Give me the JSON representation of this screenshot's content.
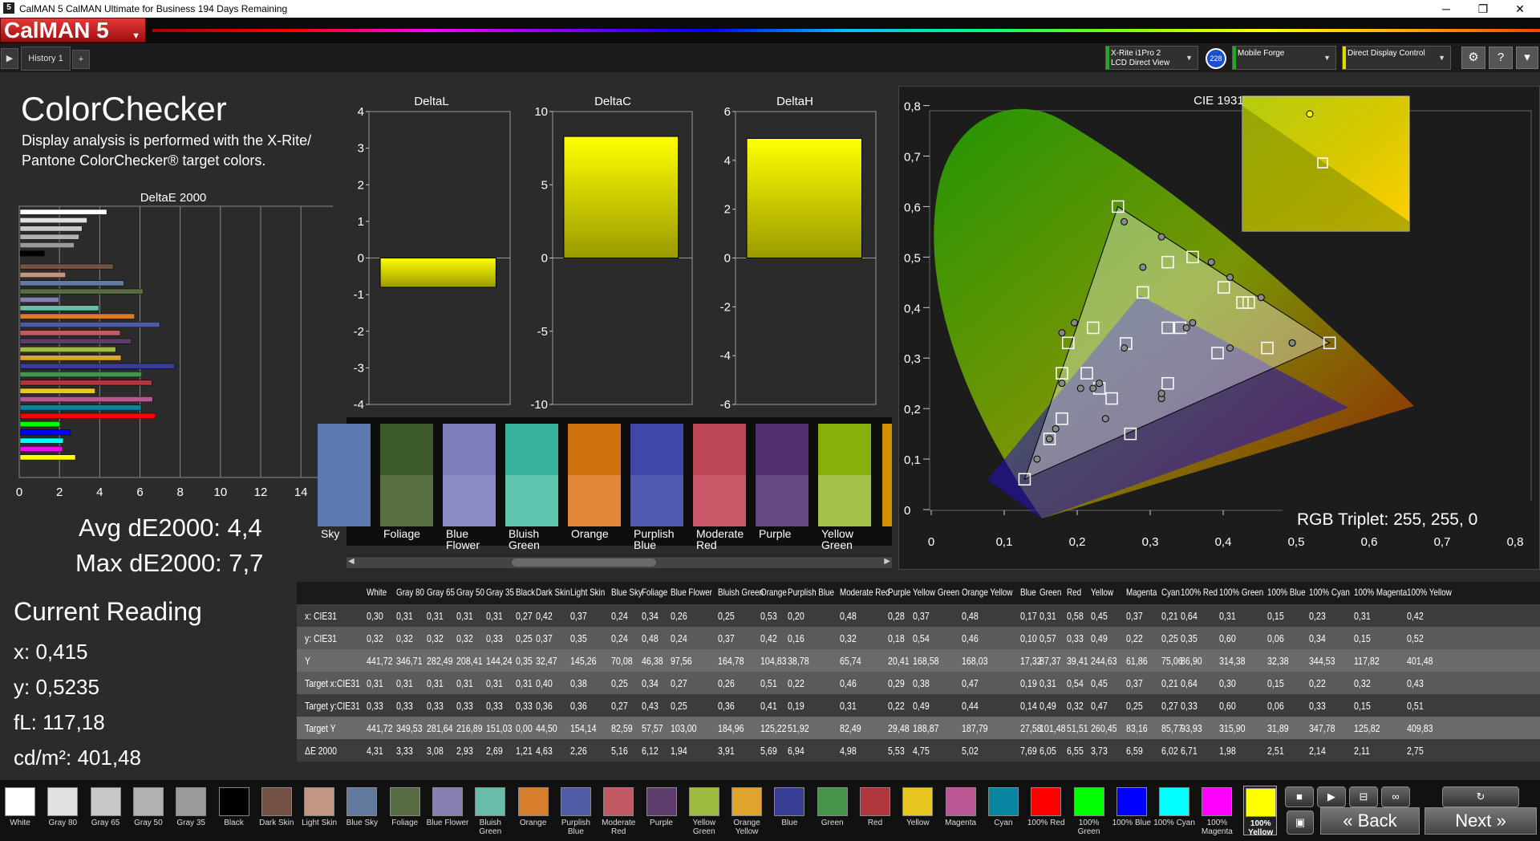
{
  "window": {
    "title": "CalMAN 5 CalMAN Ultimate for Business 194 Days Remaining",
    "app_icon": "5",
    "minimize": "─",
    "restore": "❐",
    "close": "✕"
  },
  "logo": "CalMAN 5",
  "tabs": {
    "history": "History 1",
    "add": "+"
  },
  "devices": {
    "meter_line1": "X-Rite i1Pro 2",
    "meter_line2": "LCD Direct View",
    "meter_badge": "228",
    "source": "Mobile Forge",
    "display": "Direct Display Control"
  },
  "colors": {
    "meter_bar": "#22aa22",
    "source_bar": "#22aa22",
    "display_bar": "#dddd00",
    "yellow": "#ffff00"
  },
  "left": {
    "title": "ColorChecker",
    "desc1": "Display analysis is performed with the X-Rite/",
    "desc2": "Pantone ColorChecker® target colors.",
    "de_title": "DeltaE 2000",
    "avg": "Avg dE2000: 4,4",
    "max": "Max dE2000: 7,7"
  },
  "current": {
    "title": "Current Reading",
    "x": "x: 0,415",
    "y": "y: 0,5235",
    "fl": "fL: 117,18",
    "cdm": "cd/m²: 401,48"
  },
  "delta_titles": {
    "l": "DeltaL",
    "c": "DeltaC",
    "h": "DeltaH"
  },
  "cie": {
    "title": "CIE 1931 xy",
    "triplet": "RGB Triplet: 255, 255, 0"
  },
  "swatches": [
    {
      "label": "Sky",
      "color": "#5b7bb0",
      "meas": "#5b7bb0"
    },
    {
      "label": "Foliage",
      "color": "#3d5a2c",
      "meas": "#5a6e44"
    },
    {
      "label": "Blue Flower",
      "color": "#7e7dbb",
      "meas": "#8b8bc5"
    },
    {
      "label": "Bluish Green",
      "color": "#38b49e",
      "meas": "#5ec4ae"
    },
    {
      "label": "Orange",
      "color": "#d0720c",
      "meas": "#e38637"
    },
    {
      "label": "Purplish Blue",
      "color": "#3e48a8",
      "meas": "#4f5aae"
    },
    {
      "label": "Moderate Red",
      "color": "#bc4556",
      "meas": "#c95968"
    },
    {
      "label": "Purple",
      "color": "#503070",
      "meas": "#644880"
    },
    {
      "label": "Yellow Green",
      "color": "#86b00c",
      "meas": "#a4c24a"
    }
  ],
  "chart_data": [
    {
      "type": "bar",
      "title": "DeltaE 2000",
      "orientation": "horizontal",
      "xlim": [
        0,
        15
      ],
      "xticks": [
        "0",
        "2",
        "4",
        "6",
        "8",
        "10",
        "12",
        "14"
      ],
      "categories": [
        "White",
        "Gray 80",
        "Gray 65",
        "Gray 50",
        "Gray 35",
        "Black",
        "Dark Skin",
        "Light Skin",
        "Blue Sky",
        "Foliage",
        "Blue Flower",
        "Bluish Green",
        "Orange",
        "Purplish Blue",
        "Moderate Red",
        "Purple",
        "Yellow Green",
        "Orange Yellow",
        "Blue",
        "Green",
        "Red",
        "Yellow",
        "Magenta",
        "Cyan",
        "100% Red",
        "100% Green",
        "100% Blue",
        "100% Cyan",
        "100% Magenta",
        "100% Yellow"
      ],
      "values": [
        4.31,
        3.33,
        3.08,
        2.93,
        2.69,
        1.21,
        4.63,
        2.26,
        5.16,
        6.12,
        1.94,
        3.91,
        5.69,
        6.94,
        4.98,
        5.53,
        4.75,
        5.02,
        7.69,
        6.05,
        6.55,
        3.73,
        6.59,
        6.02,
        6.71,
        1.98,
        2.51,
        2.14,
        2.11,
        2.75
      ]
    },
    {
      "type": "bar",
      "title": "DeltaL",
      "ylim": [
        -4,
        4
      ],
      "yticks": [
        "4",
        "3",
        "2",
        "1",
        "0",
        "-1",
        "-2",
        "-3",
        "-4"
      ],
      "values": [
        -0.8
      ]
    },
    {
      "type": "bar",
      "title": "DeltaC",
      "ylim": [
        -10,
        10
      ],
      "yticks": [
        "10",
        "5",
        "0",
        "-5",
        "-10"
      ],
      "values": [
        8.3
      ]
    },
    {
      "type": "bar",
      "title": "DeltaH",
      "ylim": [
        -6,
        6
      ],
      "yticks": [
        "6",
        "4",
        "2",
        "0",
        "-2",
        "-4",
        "-6"
      ],
      "values": [
        4.9
      ]
    },
    {
      "type": "scatter",
      "title": "CIE 1931 xy",
      "xlim": [
        0,
        0.8
      ],
      "ylim": [
        0,
        0.8
      ],
      "xticks": [
        "0",
        "0,1",
        "0,2",
        "0,3",
        "0,4",
        "0,5",
        "0,6",
        "0,7",
        "0,8"
      ],
      "yticks": [
        "0",
        "0,1",
        "0,2",
        "0,3",
        "0,4",
        "0,5",
        "0,6",
        "0,7",
        "0,8"
      ],
      "gamut_measured": [
        [
          0.64,
          0.33
        ],
        [
          0.3,
          0.6
        ],
        [
          0.15,
          0.06
        ]
      ],
      "targets": [
        [
          0.313,
          0.329
        ],
        [
          0.4,
          0.36
        ],
        [
          0.38,
          0.36
        ],
        [
          0.25,
          0.27
        ],
        [
          0.34,
          0.43
        ],
        [
          0.27,
          0.24
        ],
        [
          0.5,
          0.41
        ],
        [
          0.21,
          0.18
        ],
        [
          0.46,
          0.31
        ],
        [
          0.29,
          0.22
        ],
        [
          0.38,
          0.49
        ],
        [
          0.47,
          0.44
        ],
        [
          0.15,
          0.06
        ],
        [
          0.3,
          0.6
        ],
        [
          0.64,
          0.33
        ],
        [
          0.42,
          0.5
        ],
        [
          0.32,
          0.15
        ],
        [
          0.22,
          0.33
        ],
        [
          0.19,
          0.14
        ],
        [
          0.26,
          0.36
        ],
        [
          0.38,
          0.25
        ],
        [
          0.54,
          0.32
        ],
        [
          0.21,
          0.27
        ],
        [
          0.51,
          0.41
        ]
      ],
      "measured": [
        [
          0.31,
          0.32
        ],
        [
          0.41,
          0.36
        ],
        [
          0.42,
          0.37
        ],
        [
          0.24,
          0.24
        ],
        [
          0.34,
          0.48
        ],
        [
          0.26,
          0.24
        ],
        [
          0.53,
          0.42
        ],
        [
          0.2,
          0.16
        ],
        [
          0.48,
          0.32
        ],
        [
          0.28,
          0.18
        ],
        [
          0.37,
          0.54
        ],
        [
          0.45,
          0.49
        ],
        [
          0.17,
          0.1
        ],
        [
          0.31,
          0.57
        ],
        [
          0.58,
          0.33
        ],
        [
          0.45,
          0.49
        ],
        [
          0.37,
          0.22
        ],
        [
          0.21,
          0.25
        ],
        [
          0.19,
          0.14
        ],
        [
          0.23,
          0.37
        ],
        [
          0.37,
          0.23
        ],
        [
          0.58,
          0.33
        ],
        [
          0.21,
          0.35
        ],
        [
          0.48,
          0.46
        ],
        [
          0.27,
          0.25
        ]
      ]
    }
  ],
  "table": {
    "columns": [
      "White",
      "Gray 80",
      "Gray 65",
      "Gray 50",
      "Gray 35",
      "Black",
      "Dark Skin",
      "Light Skin",
      "Blue Sky",
      "Foliage",
      "Blue Flower",
      "Bluish Green",
      "Orange",
      "Purplish Blue",
      "Moderate Red",
      "Purple",
      "Yellow Green",
      "Orange Yellow",
      "Blue",
      "Green",
      "Red",
      "Yellow",
      "Magenta",
      "Cyan",
      "100% Red",
      "100% Green",
      "100% Blue",
      "100% Cyan",
      "100% Magenta",
      "100% Yellow"
    ],
    "rows": [
      {
        "label": "x: CIE31",
        "values": [
          "0,30",
          "0,31",
          "0,31",
          "0,31",
          "0,31",
          "0,27",
          "0,42",
          "0,37",
          "0,24",
          "0,34",
          "0,26",
          "0,25",
          "0,53",
          "0,20",
          "0,48",
          "0,28",
          "0,37",
          "0,48",
          "0,17",
          "0,31",
          "0,58",
          "0,45",
          "0,37",
          "0,21",
          "0,64",
          "0,31",
          "0,15",
          "0,23",
          "0,31",
          "0,42"
        ]
      },
      {
        "label": "y: CIE31",
        "values": [
          "0,32",
          "0,32",
          "0,32",
          "0,32",
          "0,33",
          "0,25",
          "0,37",
          "0,35",
          "0,24",
          "0,48",
          "0,24",
          "0,37",
          "0,42",
          "0,16",
          "0,32",
          "0,18",
          "0,54",
          "0,46",
          "0,10",
          "0,57",
          "0,33",
          "0,49",
          "0,22",
          "0,25",
          "0,35",
          "0,60",
          "0,06",
          "0,34",
          "0,15",
          "0,52"
        ]
      },
      {
        "label": "Y",
        "values": [
          "441,72",
          "346,71",
          "282,49",
          "208,41",
          "144,24",
          "0,35",
          "32,47",
          "145,26",
          "70,08",
          "46,38",
          "97,56",
          "164,78",
          "104,83",
          "38,78",
          "65,74",
          "20,41",
          "168,58",
          "168,03",
          "17,32",
          "87,37",
          "39,41",
          "244,63",
          "61,86",
          "75,06",
          "86,90",
          "314,38",
          "32,38",
          "344,53",
          "117,82",
          "401,48"
        ]
      },
      {
        "label": "Target x:CIE31",
        "values": [
          "0,31",
          "0,31",
          "0,31",
          "0,31",
          "0,31",
          "0,31",
          "0,40",
          "0,38",
          "0,25",
          "0,34",
          "0,27",
          "0,26",
          "0,51",
          "0,22",
          "0,46",
          "0,29",
          "0,38",
          "0,47",
          "0,19",
          "0,31",
          "0,54",
          "0,45",
          "0,37",
          "0,21",
          "0,64",
          "0,30",
          "0,15",
          "0,22",
          "0,32",
          "0,43"
        ]
      },
      {
        "label": "Target y:CIE31",
        "values": [
          "0,33",
          "0,33",
          "0,33",
          "0,33",
          "0,33",
          "0,33",
          "0,36",
          "0,36",
          "0,27",
          "0,43",
          "0,25",
          "0,36",
          "0,41",
          "0,19",
          "0,31",
          "0,22",
          "0,49",
          "0,44",
          "0,14",
          "0,49",
          "0,32",
          "0,47",
          "0,25",
          "0,27",
          "0,33",
          "0,60",
          "0,06",
          "0,33",
          "0,15",
          "0,51"
        ]
      },
      {
        "label": "Target Y",
        "values": [
          "441,72",
          "349,53",
          "281,64",
          "216,89",
          "151,03",
          "0,00",
          "44,50",
          "154,14",
          "82,59",
          "57,57",
          "103,00",
          "184,96",
          "125,22",
          "51,92",
          "82,49",
          "29,48",
          "188,87",
          "187,79",
          "27,58",
          "101,48",
          "51,51",
          "260,45",
          "83,16",
          "85,77",
          "93,93",
          "315,90",
          "31,89",
          "347,78",
          "125,82",
          "409,83"
        ]
      },
      {
        "label": "ΔE 2000",
        "values": [
          "4,31",
          "3,33",
          "3,08",
          "2,93",
          "2,69",
          "1,21",
          "4,63",
          "2,26",
          "5,16",
          "6,12",
          "1,94",
          "3,91",
          "5,69",
          "6,94",
          "4,98",
          "5,53",
          "4,75",
          "5,02",
          "7,69",
          "6,05",
          "6,55",
          "3,73",
          "6,59",
          "6,02",
          "6,71",
          "1,98",
          "2,51",
          "2,14",
          "2,11",
          "2,75"
        ]
      }
    ]
  },
  "bottom_swatches": [
    {
      "label": "White",
      "color": "#ffffff"
    },
    {
      "label": "Gray 80",
      "color": "#e0e0e0"
    },
    {
      "label": "Gray 65",
      "color": "#c8c8c8"
    },
    {
      "label": "Gray 50",
      "color": "#b2b2b2"
    },
    {
      "label": "Gray 35",
      "color": "#9a9a9a"
    },
    {
      "label": "Black",
      "color": "#000000"
    },
    {
      "label": "Dark Skin",
      "color": "#735244"
    },
    {
      "label": "Light Skin",
      "color": "#c29682"
    },
    {
      "label": "Blue Sky",
      "color": "#627a9d"
    },
    {
      "label": "Foliage",
      "color": "#576c43"
    },
    {
      "label": "Blue Flower",
      "color": "#8580b1"
    },
    {
      "label": "Bluish Green",
      "color": "#67bdaa"
    },
    {
      "label": "Orange",
      "color": "#d67e2c"
    },
    {
      "label": "Purplish Blue",
      "color": "#505ba6"
    },
    {
      "label": "Moderate Red",
      "color": "#c15a63"
    },
    {
      "label": "Purple",
      "color": "#5e3c6c"
    },
    {
      "label": "Yellow Green",
      "color": "#9dbc40"
    },
    {
      "label": "Orange Yellow",
      "color": "#e0a32e"
    },
    {
      "label": "Blue",
      "color": "#383d96"
    },
    {
      "label": "Green",
      "color": "#469449"
    },
    {
      "label": "Red",
      "color": "#af363c"
    },
    {
      "label": "Yellow",
      "color": "#e7c71f"
    },
    {
      "label": "Magenta",
      "color": "#bb5695"
    },
    {
      "label": "Cyan",
      "color": "#0885a1"
    },
    {
      "label": "100% Red",
      "color": "#ff0000"
    },
    {
      "label": "100% Green",
      "color": "#00ff00"
    },
    {
      "label": "100% Blue",
      "color": "#0000ff"
    },
    {
      "label": "100% Cyan",
      "color": "#00ffff"
    },
    {
      "label": "100% Magenta",
      "color": "#ff00ff"
    },
    {
      "label": "100% Yellow",
      "color": "#ffff00"
    }
  ],
  "nav": {
    "back": "Back",
    "next": "Next",
    "back_icon": "«",
    "next_icon": "»"
  }
}
